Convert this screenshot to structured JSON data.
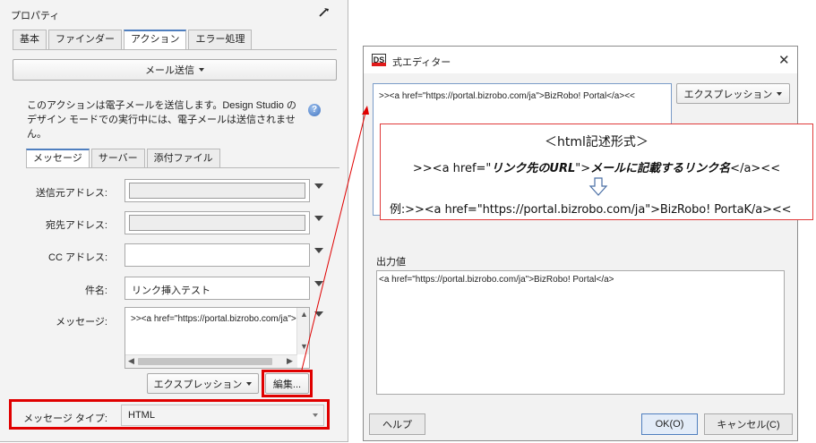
{
  "properties": {
    "title": "プロパティ",
    "tabs": [
      "基本",
      "ファインダー",
      "アクション",
      "エラー処理"
    ],
    "action_dropdown": "メール送信",
    "description": "このアクションは電子メールを送信します。Design Studio のデザイン モードでの実行中には、電子メールは送信されません。",
    "subtabs": [
      "メッセージ",
      "サーバー",
      "添付ファイル"
    ],
    "fields": {
      "from_label": "送信元アドレス:",
      "to_label": "宛先アドレス:",
      "cc_label": "CC アドレス:",
      "subject_label": "件名:",
      "subject_value": "リンク挿入テスト",
      "message_label": "メッセージ:",
      "message_value": ">><a href=\"https://portal.bizrobo.com/ja\">BizRobo! Portal</a><<"
    },
    "expression_button": "エクスプレッション",
    "edit_button": "編集...",
    "message_type_label": "メッセージ タイプ:",
    "message_type_value": "HTML"
  },
  "dialog": {
    "title": "式エディター",
    "icon_label": "DS",
    "expression_text": ">><a href=\"https://portal.bizrobo.com/ja\">BizRobo! Portal</a><<",
    "expression_button": "エクスプレッション",
    "output_label": "出力値",
    "output_text": "<a href=\"https://portal.bizrobo.com/ja\">BizRobo! Portal</a>",
    "help_button": "ヘルプ",
    "ok_button": "OK(O)",
    "cancel_button": "キャンセル(C)"
  },
  "callout": {
    "heading": "＜html記述形式＞",
    "format_prefix": ">><a href=\"",
    "format_url": "リンク先のURL",
    "format_middle": "\">",
    "format_name": "メールに記載するリンク名",
    "format_suffix": "</a><<",
    "example": "例:>><a href=\"https://portal.bizrobo.com/ja\">BizRobo! PortaK/a><<"
  },
  "colors": {
    "highlight": "#e00000",
    "tab_accent": "#4f7fbf",
    "ds_icon_red": "#e01b1b"
  }
}
